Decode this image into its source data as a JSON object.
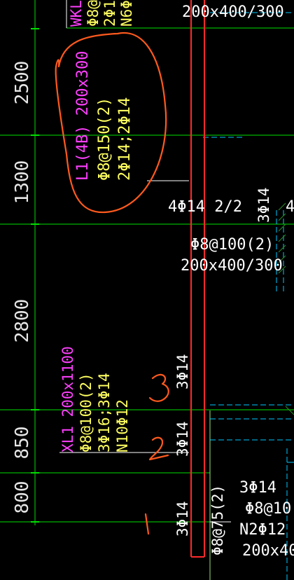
{
  "dimensions": [
    {
      "id": "dim-2500",
      "text": "2500"
    },
    {
      "id": "dim-1300",
      "text": "1300"
    },
    {
      "id": "dim-2800",
      "text": "2800"
    },
    {
      "id": "dim-850",
      "text": "850"
    },
    {
      "id": "dim-800",
      "text": "800"
    }
  ],
  "wkl": {
    "label_partial": "WKL",
    "line2_partial": "Φ8@",
    "line3_partial": "2Φ1",
    "line4_partial": "N6Φ",
    "section": "200x400/300"
  },
  "l1": {
    "name": "L1(4B) 200x300",
    "stirrup": "Φ8@150(2)",
    "bars": "2Φ14;2Φ14"
  },
  "top_bars": "4Φ14 2/2",
  "right_col_bars": "3Φ14",
  "right_col_bars_partial": "4",
  "mid_beam": {
    "stirrup": "Φ8@100(2)",
    "section": "200x400/300"
  },
  "xl1": {
    "name": "XL1 200x1100",
    "stirrup": "Φ8@100(2)",
    "bars": "3Φ16;3Φ14",
    "side_bars": "N10Φ12"
  },
  "vertical_bars": {
    "upper": "3Φ14",
    "middle": "3Φ14",
    "lower": "3Φ14"
  },
  "bottom_vertical": "Φ8@75(2)",
  "bottom_right": {
    "bars": "3Φ14",
    "stirrup": "Φ8@10",
    "side_bars": "N2Φ12",
    "section": "200x40"
  },
  "annotations": {
    "mark1": "1",
    "mark2": "2",
    "mark3": "3"
  },
  "colors": {
    "background": "#000000",
    "grid_green": "#00ff00",
    "beam_red": "#ff2a2a",
    "annotation_orange": "#ff5a1e",
    "text_white": "#ffffff",
    "text_magenta": "#ff40ff",
    "text_yellow": "#ffff60",
    "structure_cyan": "#00d8ff",
    "dim_text": "#e8e8e8"
  }
}
